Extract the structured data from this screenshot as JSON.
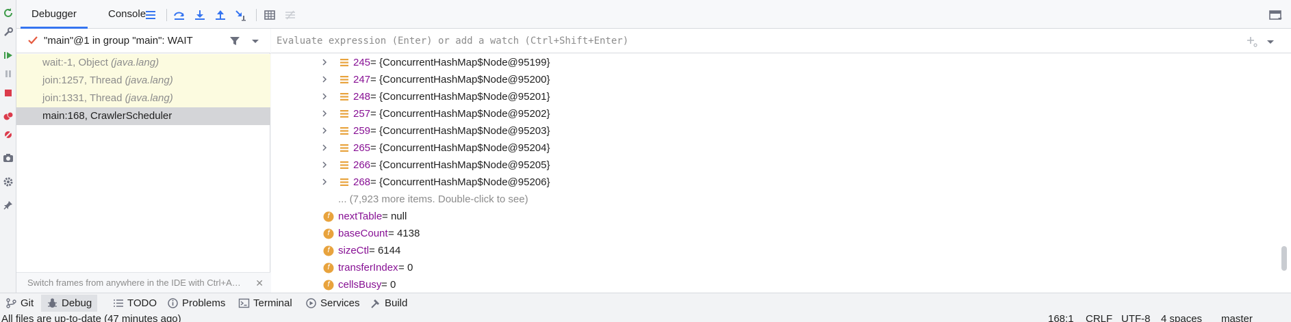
{
  "tabs": {
    "debugger": "Debugger",
    "console": "Console"
  },
  "thread": {
    "label": "\"main\"@1 in group \"main\": WAIT"
  },
  "frames": [
    {
      "method": "wait:-1, Object ",
      "pkg": "(java.lang)",
      "style": "lib"
    },
    {
      "method": "join:1257, Thread ",
      "pkg": "(java.lang)",
      "style": "lib"
    },
    {
      "method": "join:1331, Thread ",
      "pkg": "(java.lang)",
      "style": "lib"
    },
    {
      "method": "main:168, CrawlerScheduler",
      "pkg": "",
      "style": "selected"
    }
  ],
  "frames_hint": "Switch frames from anywhere in the IDE with Ctrl+A…",
  "watch": {
    "placeholder": "Evaluate expression (Enter) or add a watch (Ctrl+Shift+Enter)"
  },
  "entries": [
    {
      "index": "245",
      "value": "{ConcurrentHashMap$Node@95199}"
    },
    {
      "index": "247",
      "value": "{ConcurrentHashMap$Node@95200}"
    },
    {
      "index": "248",
      "value": "{ConcurrentHashMap$Node@95201}"
    },
    {
      "index": "257",
      "value": "{ConcurrentHashMap$Node@95202}"
    },
    {
      "index": "259",
      "value": "{ConcurrentHashMap$Node@95203}"
    },
    {
      "index": "265",
      "value": "{ConcurrentHashMap$Node@95204}"
    },
    {
      "index": "266",
      "value": "{ConcurrentHashMap$Node@95205}"
    },
    {
      "index": "268",
      "value": "{ConcurrentHashMap$Node@95206}"
    }
  ],
  "more_items": "... (7,923 more items. Double-click to see)",
  "fields": [
    {
      "name": "nextTable",
      "value": "null"
    },
    {
      "name": "baseCount",
      "value": "4138"
    },
    {
      "name": "sizeCtl",
      "value": "6144"
    },
    {
      "name": "transferIndex",
      "value": "0"
    },
    {
      "name": "cellsBusy",
      "value": "0"
    }
  ],
  "eq": " = ",
  "field_badge": "f",
  "tool_windows": {
    "git": "Git",
    "debug": "Debug",
    "todo": "TODO",
    "problems": "Problems",
    "terminal": "Terminal",
    "services": "Services",
    "build": "Build"
  },
  "status": {
    "message": "All files are up-to-date (47 minutes ago)",
    "position": "168:1",
    "line_sep": "CRLF",
    "encoding": "UTF-8",
    "indent": "4 spaces",
    "branch": "master"
  },
  "colors": {
    "accent": "#3574f0",
    "var_name": "#871094",
    "lib_frame_bg": "#fcfbe0",
    "selected_frame_bg": "#d4d5d8",
    "field_badge": "#e8a33d"
  }
}
